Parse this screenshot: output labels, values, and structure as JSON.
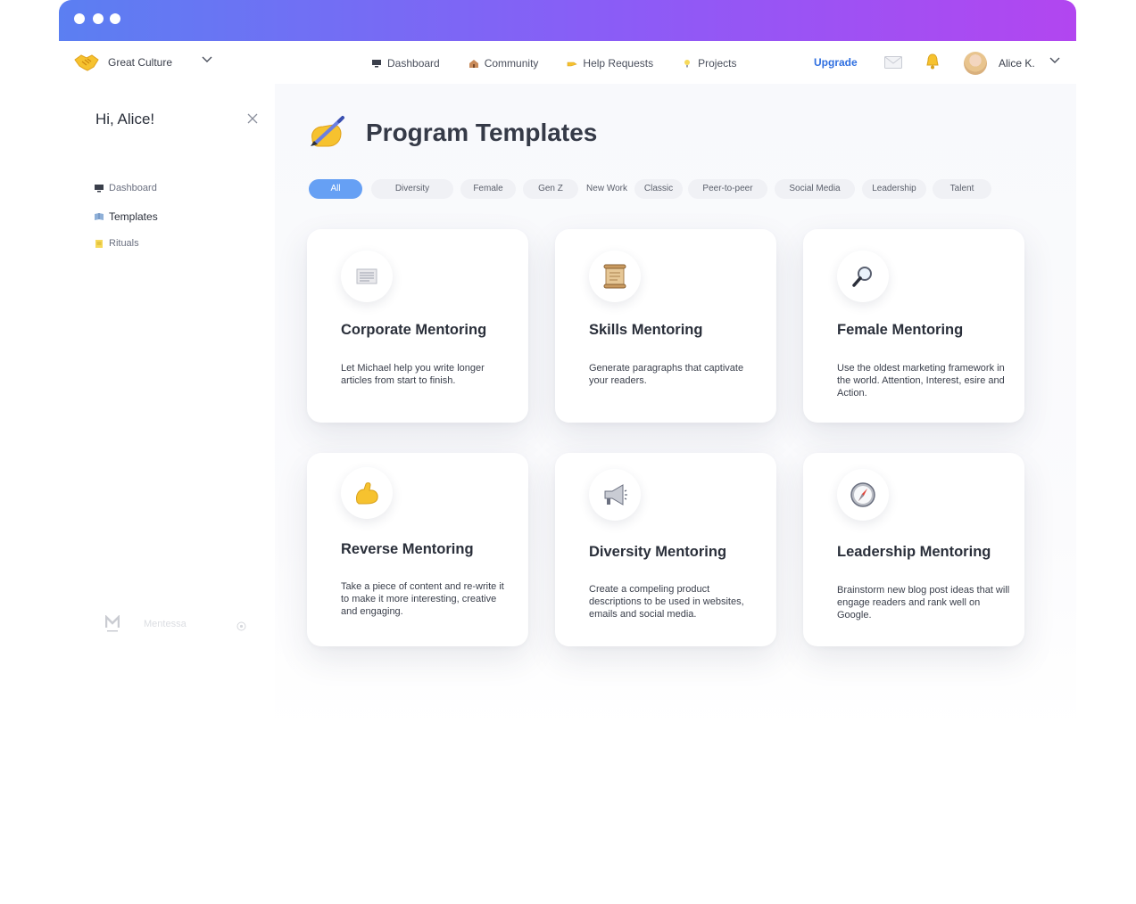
{
  "window": {
    "titlebar_colors": [
      "#5b7ff2",
      "#b246f0"
    ]
  },
  "topnav": {
    "org_name": "Great Culture",
    "links": [
      {
        "label": "Dashboard",
        "icon": "monitor-icon"
      },
      {
        "label": "Community",
        "icon": "house-icon"
      },
      {
        "label": "Help Requests",
        "icon": "pointing-hand-icon"
      },
      {
        "label": "Projects",
        "icon": "lightbulb-icon"
      }
    ],
    "upgrade_label": "Upgrade",
    "user_name": "Alice K."
  },
  "sidebar": {
    "greeting": "Hi, Alice!",
    "items": [
      {
        "label": "Dashboard",
        "icon": "monitor-icon",
        "active": false
      },
      {
        "label": "Templates",
        "icon": "book-icon",
        "active": true
      },
      {
        "label": "Rituals",
        "icon": "note-icon",
        "active": false
      }
    ],
    "brand_name": "Mentessa"
  },
  "main": {
    "title": "Program Templates",
    "filters": [
      "All",
      "Diversity",
      "Female",
      "Gen Z",
      "New Work",
      "Classic",
      "Peer-to-peer",
      "Social Media",
      "Leadership",
      "Talent"
    ],
    "active_filter": "All",
    "cards": [
      {
        "title": "Corporate Mentoring",
        "description": "Let Michael help you write longer articles from start to finish.",
        "icon": "newspaper-icon"
      },
      {
        "title": "Skills Mentoring",
        "description": "Generate paragraphs that captivate your readers.",
        "icon": "scroll-icon"
      },
      {
        "title": "Female Mentoring",
        "description": "Use the oldest marketing framework in the world. Attention, Interest, esire and Action.",
        "icon": "magnifier-icon"
      },
      {
        "title": "Reverse Mentoring",
        "description": "Take a piece of content and re-write it to make it more interesting, creative and engaging.",
        "icon": "flexed-biceps-icon"
      },
      {
        "title": "Diversity Mentoring",
        "description": "Create a compeling product descriptions to be used in websites, emails and social media.",
        "icon": "megaphone-icon"
      },
      {
        "title": "Leadership Mentoring",
        "description": "Brainstorm new blog post ideas that will engage readers and rank well on Google.",
        "icon": "compass-icon"
      }
    ]
  },
  "colors": {
    "accent": "#2f6fe0",
    "chip_active": "#66a0f4"
  }
}
